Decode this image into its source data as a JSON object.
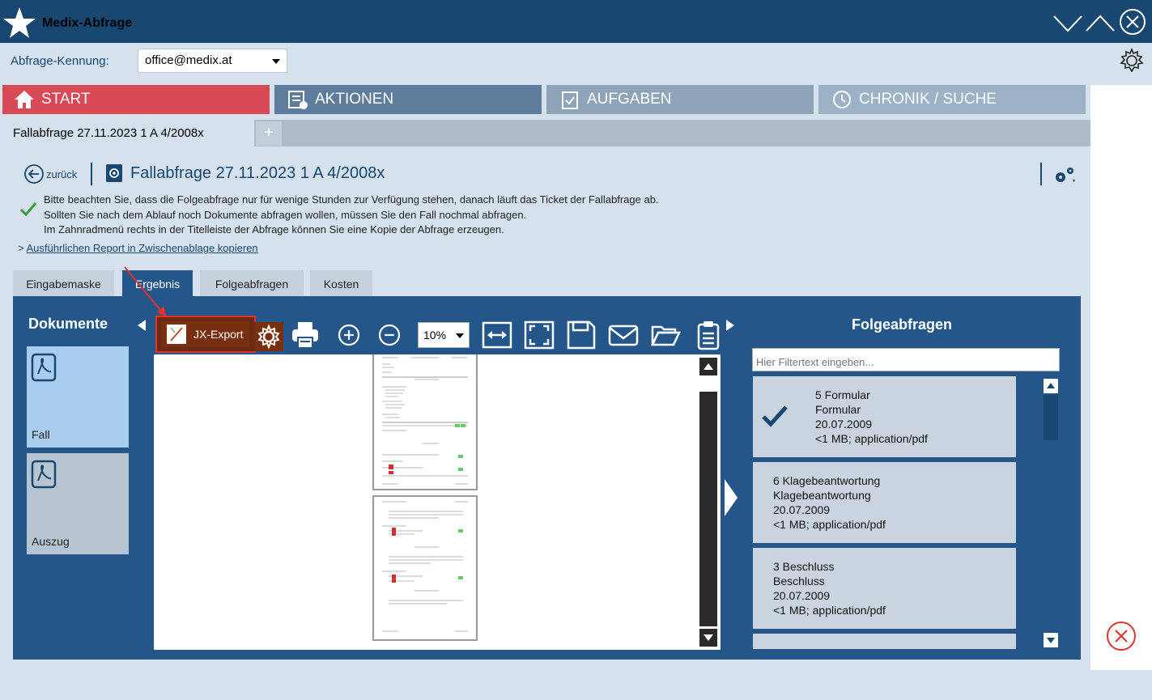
{
  "window": {
    "title": "Medix-Abfrage"
  },
  "query_id": {
    "label": "Abfrage-Kennung:",
    "value": "office@medix.at"
  },
  "main_tabs": [
    {
      "label": "START",
      "color": "#d84a55"
    },
    {
      "label": "AKTIONEN",
      "color": "#5c7d9c"
    },
    {
      "label": "AUFGABEN",
      "color": "#8ea4b8"
    },
    {
      "label": "CHRONIK / SUCHE",
      "color": "#9cb2c6"
    }
  ],
  "subtab": {
    "label": "Fallabfrage 27.11.2023 1 A 4/2008x",
    "plus": "+"
  },
  "header": {
    "back_label": "zurück",
    "title": "Fallabfrage 27.11.2023 1 A 4/2008x"
  },
  "info": {
    "line1": "Bitte beachten Sie, dass die Folgeabfrage nur für wenige Stunden zur Verfügung stehen, danach läuft das Ticket der Fallabfrage ab.",
    "line2": "Sollten Sie nach dem Ablauf noch Dokumente abfragen wollen, müssen Sie den Fall nochmal abfragen.",
    "line3": "Im Zahnradmenü rechts in der Titelleiste der Abfrage können Sie eine Kopie der Abfrage erzeugen."
  },
  "report_link": {
    "prefix": ">",
    "label": "Ausführlichen Report in Zwischenablage kopieren"
  },
  "form_tabs": [
    "Eingabemaske",
    "Ergebnis",
    "Folgeabfragen",
    "Kosten"
  ],
  "documents": {
    "title": "Dokumente",
    "items": [
      {
        "name": "Fall"
      },
      {
        "name": "Auszug"
      }
    ]
  },
  "toolbar": {
    "jx_export": "JX-Export",
    "zoom": "10%"
  },
  "followups": {
    "title": "Folgeabfragen",
    "filter_placeholder": "Hier Filtertext eingeben...",
    "items": [
      {
        "l1": "5 Formular",
        "l2": "Formular",
        "l3": "20.07.2009",
        "l4": "<1 MB; application/pdf"
      },
      {
        "l1": "6 Klagebeantwortung",
        "l2": "Klagebeantwortung",
        "l3": "20.07.2009",
        "l4": "<1 MB; application/pdf"
      },
      {
        "l1": "3 Beschluss",
        "l2": "Beschluss",
        "l3": "20.07.2009",
        "l4": "<1 MB; application/pdf"
      }
    ]
  }
}
